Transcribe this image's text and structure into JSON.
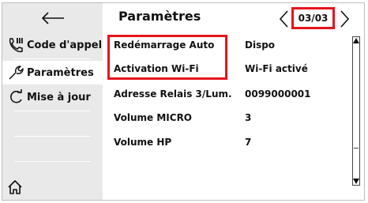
{
  "header": {
    "title": "Paramètres",
    "page_indicator": "03/03"
  },
  "sidebar": {
    "items": [
      {
        "label": "Code d'appel",
        "icon": "phone-icon"
      },
      {
        "label": "Paramètres",
        "icon": "wrench-icon"
      },
      {
        "label": "Mise à jour",
        "icon": "refresh-icon"
      }
    ]
  },
  "settings": {
    "rows": [
      {
        "label": "Redémarrage Auto",
        "value": "Dispo"
      },
      {
        "label": "Activation Wi-Fi",
        "value": "Wi-Fi activé"
      },
      {
        "label": "Adresse Relais 3/Lum.",
        "value": "0099000001"
      },
      {
        "label": "Volume MICRO",
        "value": "3"
      },
      {
        "label": "Volume HP",
        "value": "7"
      }
    ]
  },
  "colors": {
    "highlight": "#e8141c",
    "sidebar_bg": "#e9e9e9"
  }
}
